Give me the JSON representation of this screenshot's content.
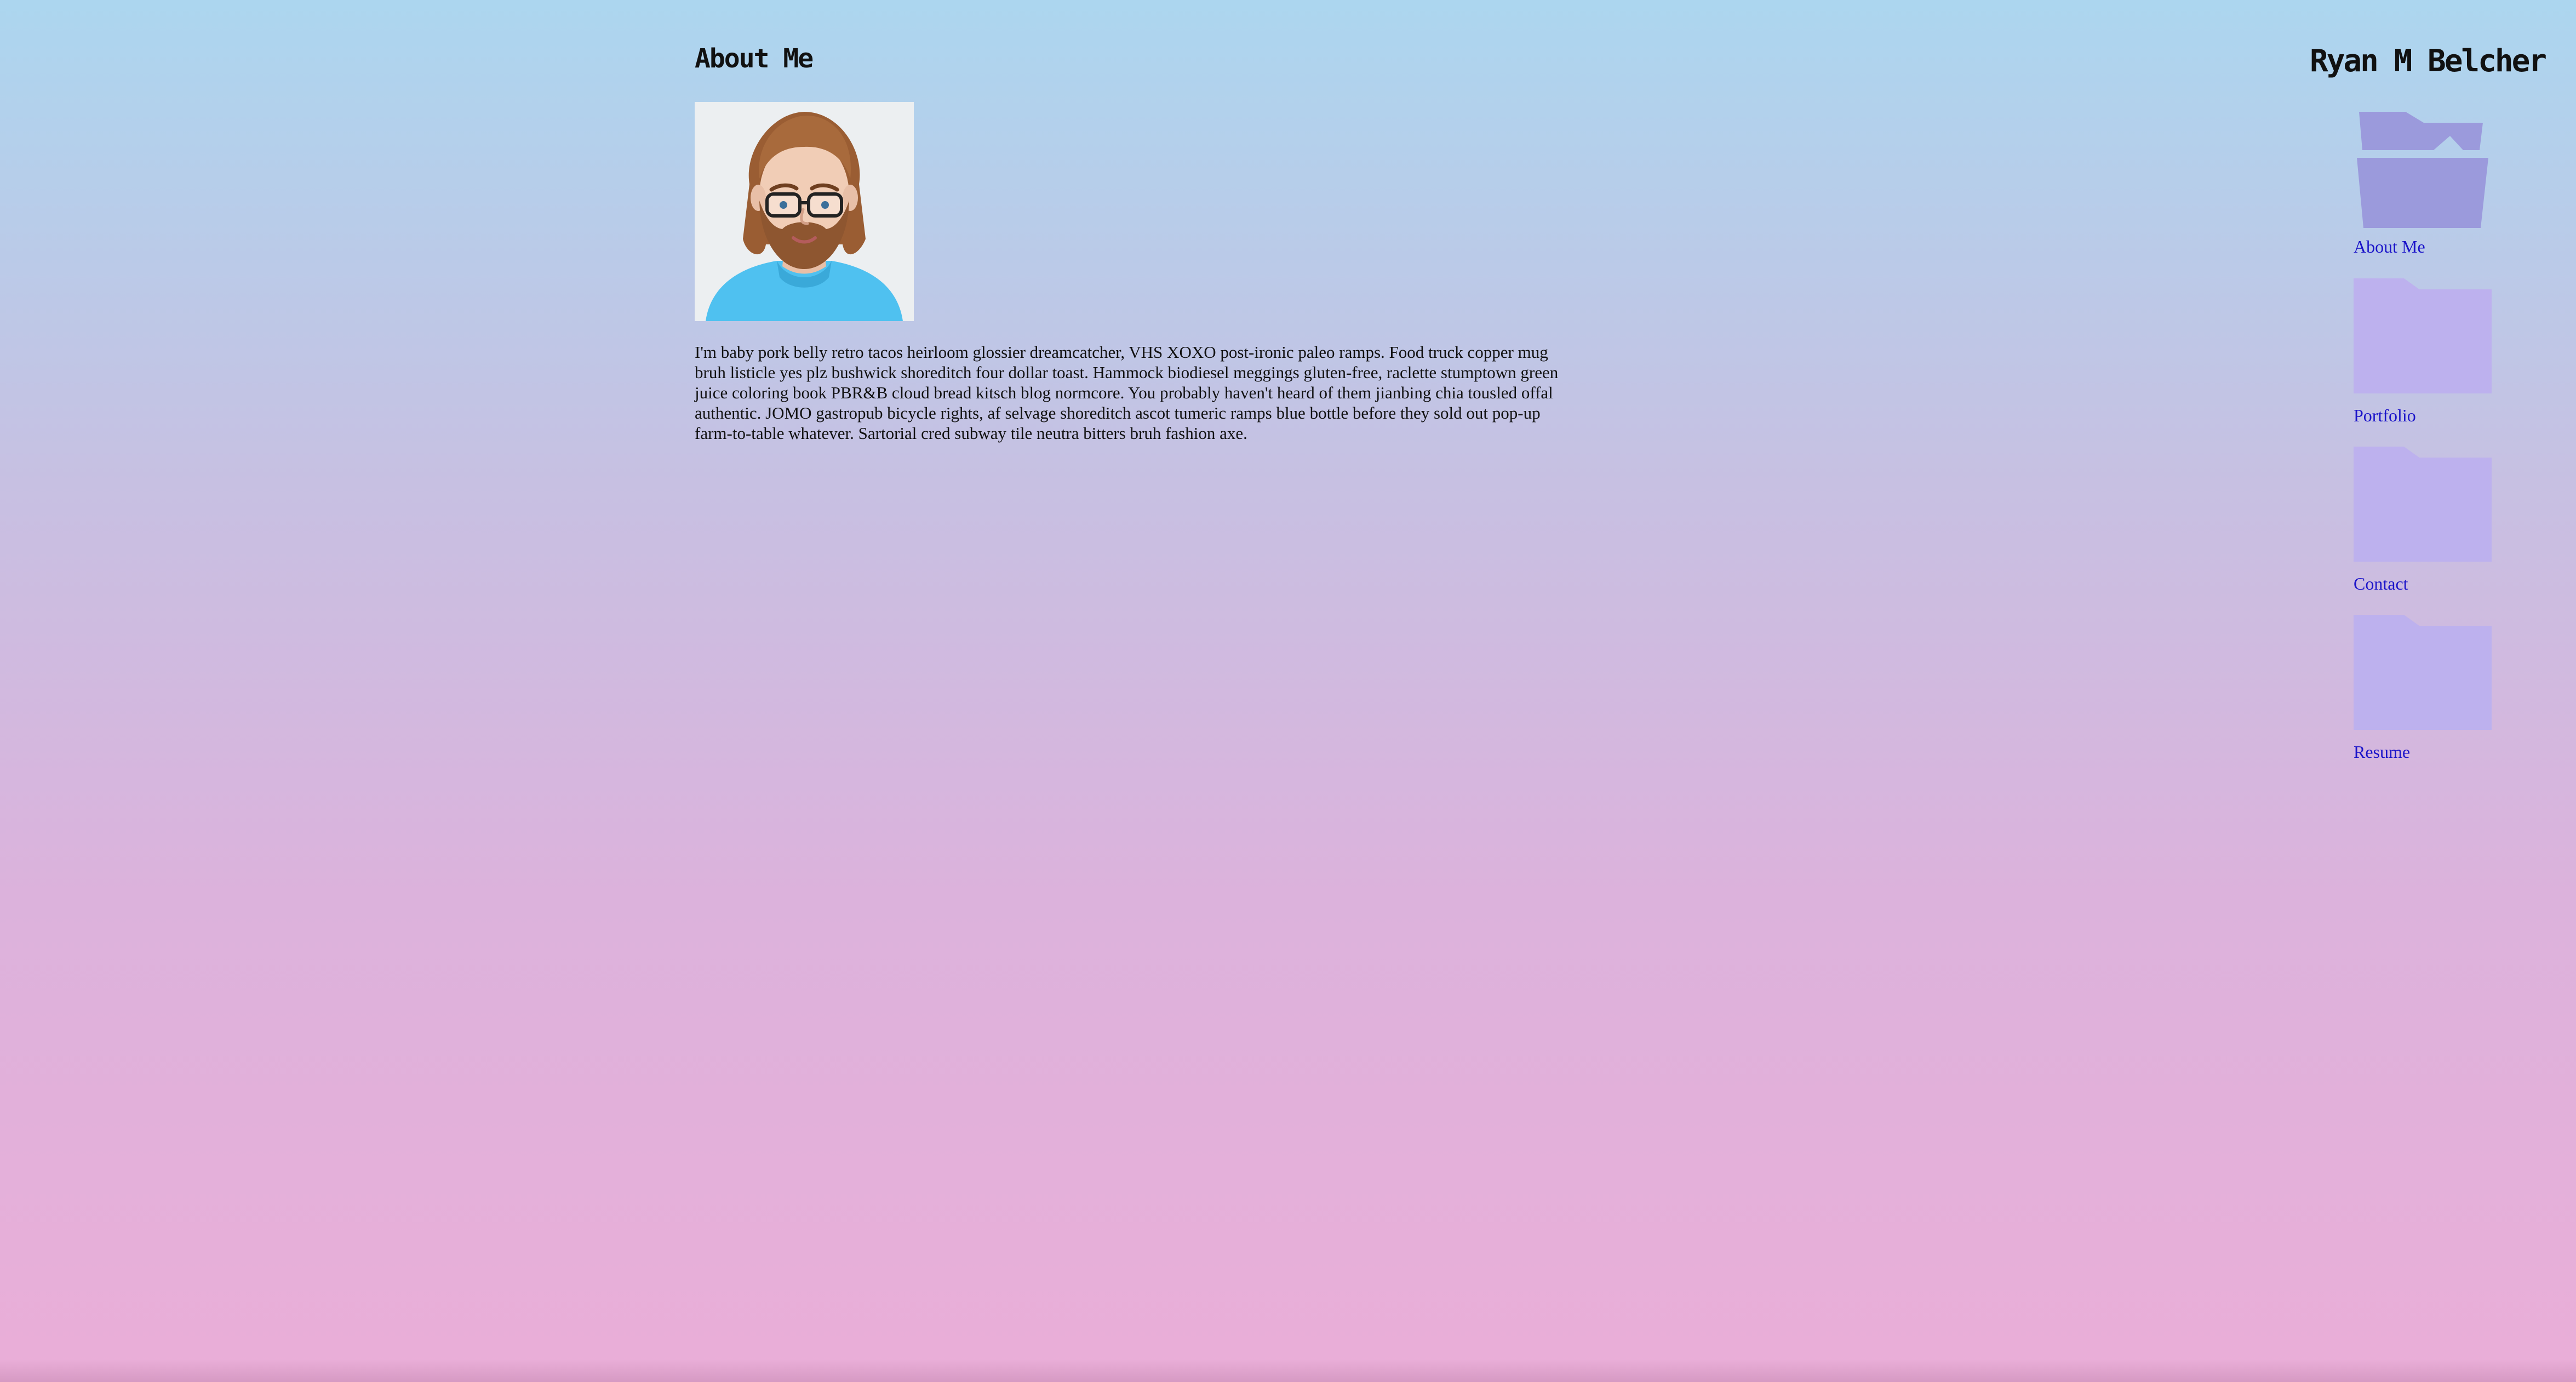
{
  "main": {
    "title": "About Me",
    "bio": "I'm baby pork belly retro tacos heirloom glossier dreamcatcher, VHS XOXO post-ironic paleo ramps. Food truck copper mug bruh listicle yes plz bushwick shoreditch four dollar toast. Hammock biodiesel meggings gluten-free, raclette stumptown green juice coloring book PBR&B cloud bread kitsch blog normcore. You probably haven't heard of them jianbing chia tousled offal authentic. JOMO gastropub bicycle rights, af selvage shoreditch ascot tumeric ramps blue bottle before they sold out pop-up farm-to-table whatever. Sartorial cred subway tile neutra bitters bruh fashion axe.",
    "avatar_icon": "bearded-man-avatar"
  },
  "site": {
    "name": "Ryan M Belcher"
  },
  "nav": {
    "items": [
      {
        "label": "About Me",
        "icon": "folder-open-icon",
        "active": true
      },
      {
        "label": "Portfolio",
        "icon": "folder-icon",
        "active": false
      },
      {
        "label": "Contact",
        "icon": "folder-icon",
        "active": false
      },
      {
        "label": "Resume",
        "icon": "folder-icon",
        "active": false
      }
    ]
  },
  "colors": {
    "background_top": "#acd6ef",
    "background_bottom": "#eaaed8",
    "folder_active": "#9b9adc",
    "folder_inactive": "#bdb1ee",
    "link": "#1b14c9"
  }
}
